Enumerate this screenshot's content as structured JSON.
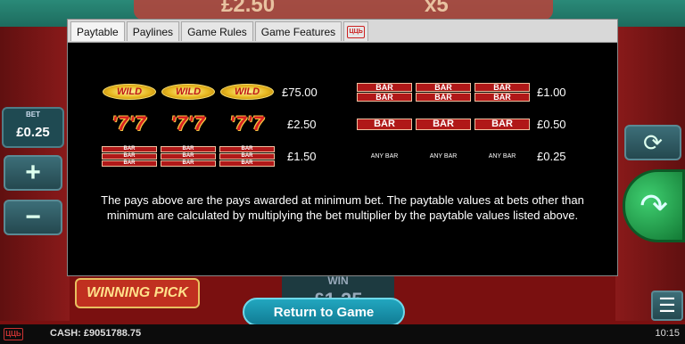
{
  "background": {
    "top_amount": "£2.50",
    "top_multiplier": "x5",
    "bet_label": "BET",
    "bet_value": "£0.25",
    "plus_label": "+",
    "minus_label": "−",
    "logo_text": "WINNING PICK",
    "win_label": "WIN",
    "win_value": "£1.25"
  },
  "tabs": [
    {
      "label": "Paytable",
      "active": true
    },
    {
      "label": "Paylines",
      "active": false
    },
    {
      "label": "Game Rules",
      "active": false
    },
    {
      "label": "Game Features",
      "active": false
    }
  ],
  "brand_logo_text": "ЦЦЬ",
  "paytable": {
    "left": [
      {
        "symbol": "WILD",
        "prize": "£75.00"
      },
      {
        "symbol": "7",
        "prize": "£2.50"
      },
      {
        "symbol": "BAR",
        "prize": "£1.50"
      }
    ],
    "right": [
      {
        "symbol": "BAR",
        "prize": "£1.00"
      },
      {
        "symbol": "BAR",
        "prize": "£0.50"
      },
      {
        "symbol": "ANY BAR",
        "prize": "£0.25"
      }
    ],
    "note": "The pays above are the pays awarded at minimum bet. The paytable values at bets other than minimum are calculated by multiplying the bet multiplier by the paytable values listed above."
  },
  "return_button": "Return to Game",
  "footer": {
    "cash": "CASH: £9051788.75",
    "time": "10:15"
  },
  "colors": {
    "accent": "#1a9bb4",
    "dialog_bg": "#000000",
    "bar_red": "#b01818"
  }
}
